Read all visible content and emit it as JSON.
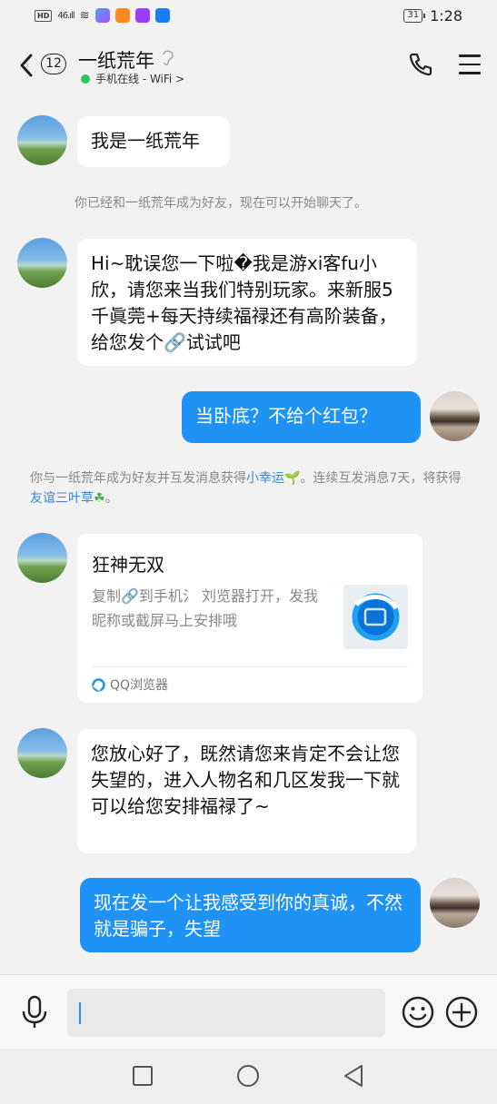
{
  "status_bar": {
    "hd": "HD",
    "network": "46",
    "battery": "31",
    "time": "1:28"
  },
  "header": {
    "badge_count": "12",
    "title": "一纸荒年",
    "online_status": "手机在线 - WiFi >"
  },
  "messages": [
    {
      "id": "m1",
      "side": "left",
      "text": "我是一纸荒年"
    },
    {
      "id": "sys1",
      "type": "system",
      "text": "你已经和一纸荒年成为好友，现在可以开始聊天了。"
    },
    {
      "id": "m2",
      "side": "left",
      "text": "Hi~耽误您一下啦�我是游xi客fu小欣，请您来当我们特别玩家。来新服5千眞莞+每天持续福禄还有高阶装备，给您发个🔗试试吧"
    },
    {
      "id": "m3",
      "side": "right",
      "text": "当卧底？不给个红包？"
    },
    {
      "id": "sys2",
      "type": "system",
      "text_a": "你与一纸荒年成为好友并互发消息获得",
      "link_a": "小幸运",
      "text_b": "。连续互发消息7天，将获得",
      "link_b": "友谊三叶草",
      "text_c": "。"
    },
    {
      "id": "m4",
      "side": "left",
      "type": "card",
      "title": "狂神无双",
      "desc": "复制🔗到手机氵 刘览器打开，发我昵称或截屏马上安排哦",
      "source": "QQ浏览器"
    },
    {
      "id": "m5",
      "side": "left",
      "text": "您放心好了，既然请您来肯定不会让您失望的，进入人物名和几区发我一下就可以给您安排福禄了~"
    },
    {
      "id": "m6",
      "side": "right",
      "text": "现在发一个让我感受到你的真诚，不然就是骗子，失望"
    }
  ],
  "input": {
    "value": ""
  },
  "icons": {
    "back": "chevron-left-icon",
    "phone": "phone-icon",
    "menu": "menu-icon",
    "mic": "microphone-icon",
    "emoji": "emoji-icon",
    "plus": "plus-icon"
  },
  "colors": {
    "accent": "#1e92f5",
    "online": "#2fc55a",
    "link": "#3a86d6"
  }
}
